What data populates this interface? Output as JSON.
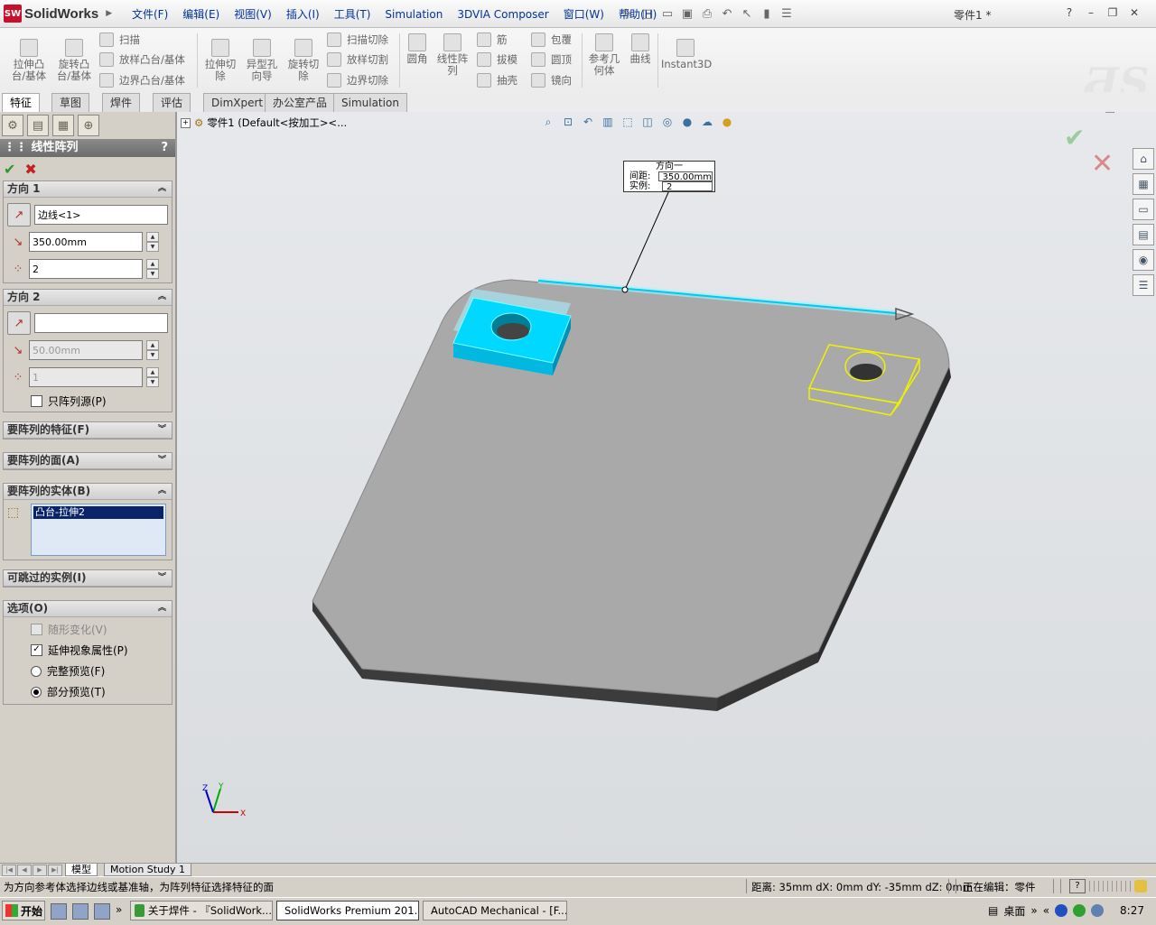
{
  "app": {
    "brand_mark": "SW",
    "brand_name": "SolidWorks",
    "doc_title": "零件1 *"
  },
  "menu": [
    "文件(F)",
    "编辑(E)",
    "视图(V)",
    "插入(I)",
    "工具(T)",
    "Simulation",
    "3DVIA Composer",
    "窗口(W)",
    "帮助(H)"
  ],
  "commands": {
    "extrude_boss": "拉伸凸\n台/基体",
    "revolve_boss": "旋转凸\n台/基体",
    "sweep": "扫描",
    "loft_boss": "放样凸台/基体",
    "boundary_boss": "边界凸台/基体",
    "extrude_cut": "拉伸切\n除",
    "hole_wizard": "异型孔\n向导",
    "revolve_cut": "旋转切\n除",
    "swept_cut": "扫描切除",
    "lofted_cut": "放样切割",
    "boundary_cut": "边界切除",
    "fillet": "圆角",
    "linear_pattern": "线性阵\n列",
    "rib": "筋",
    "draft": "拔模",
    "shell": "抽壳",
    "wrap": "包覆",
    "dome": "圆顶",
    "mirror": "镜向",
    "ref_geometry": "参考几\n何体",
    "curves": "曲线",
    "instant3d": "Instant3D"
  },
  "tabs": [
    "特征",
    "草图",
    "焊件",
    "评估",
    "DimXpert",
    "办公室产品",
    "Simulation"
  ],
  "panel": {
    "title": "线性阵列",
    "help": "?",
    "dir1": {
      "header": "方向 1",
      "edge": "边线<1>",
      "spacing": "350.00mm",
      "instances": "2"
    },
    "dir2": {
      "header": "方向 2",
      "edge": "",
      "spacing": "50.00mm",
      "instances": "1",
      "pattern_seed_only": "只阵列源(P)"
    },
    "features_to_pattern": "要阵列的特征(F)",
    "faces_to_pattern": "要阵列的面(A)",
    "bodies_to_pattern": "要阵列的实体(B)",
    "selected_body": "凸台-拉伸2",
    "instances_to_skip": "可跳过的实例(I)",
    "options": {
      "header": "选项(O)",
      "geometry_pattern": "随形变化(V)",
      "propagate_visual": "延伸视象属性(P)",
      "full_preview": "完整预览(F)",
      "partial_preview": "部分预览(T)"
    }
  },
  "viewport": {
    "tree_label": "零件1  (Default<按加工><...",
    "callout": {
      "title": "方向一",
      "spacing_label": "间距:",
      "spacing_value": "350.00mm",
      "instances_label": "实例:",
      "instances_value": "2"
    },
    "triad": {
      "x": "X",
      "y": "Y",
      "z": "Z"
    }
  },
  "bottom_tabs": [
    "模型",
    "Motion Study 1"
  ],
  "status": {
    "message": "为方向参考体选择边线或基准轴，为阵列特征选择特征的面",
    "coords": "距离: 35mm  dX: 0mm  dY: -35mm  dZ: 0mm",
    "editing": "正在编辑：零件"
  },
  "taskbar": {
    "start": "开始",
    "buttons": [
      "关于焊件 - 『SolidWork...",
      "SolidWorks Premium 201...",
      "AutoCAD Mechanical - [F..."
    ],
    "desktop": "桌面",
    "clock": "8:27"
  },
  "colors": {
    "selection": "#00d8ff",
    "preview": "#f0f000",
    "part": "#a9a9a9"
  }
}
